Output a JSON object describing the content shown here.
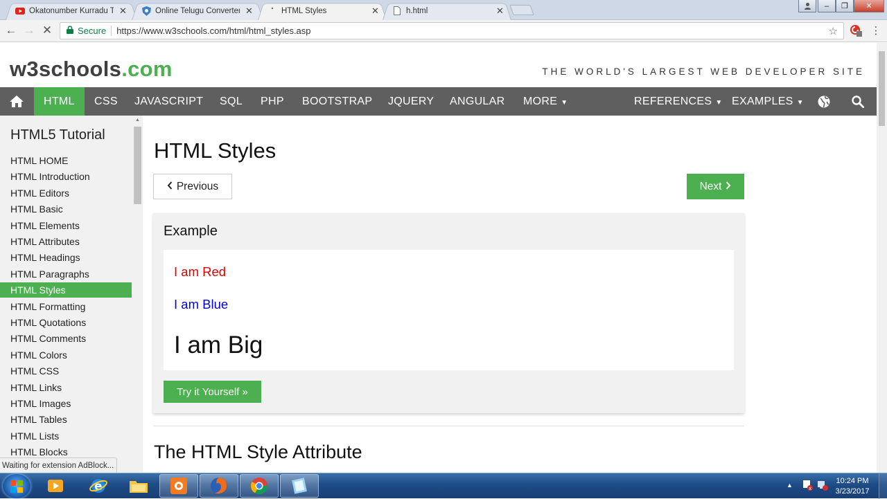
{
  "browser": {
    "tabs": [
      {
        "title": "Okatonumber Kurradu Te",
        "icon": "youtube-icon",
        "active": false
      },
      {
        "title": "Online Telugu Converter",
        "icon": "shield-icon",
        "active": false
      },
      {
        "title": "HTML Styles",
        "icon": "loading-icon",
        "active": true
      },
      {
        "title": "h.html",
        "icon": "file-icon",
        "active": false
      }
    ],
    "secure_label": "Secure",
    "url": "https://www.w3schools.com/html/html_styles.asp",
    "status_text": "Waiting for extension AdBlock..."
  },
  "site": {
    "logo_main": "w3schools",
    "logo_dot": ".com",
    "tagline": "THE WORLD'S LARGEST WEB DEVELOPER SITE",
    "nav": [
      "HTML",
      "CSS",
      "JAVASCRIPT",
      "SQL",
      "PHP",
      "BOOTSTRAP",
      "JQUERY",
      "ANGULAR",
      "MORE"
    ],
    "nav_right": [
      "REFERENCES",
      "EXAMPLES"
    ],
    "accent": "#4caf50"
  },
  "sidebar": {
    "title": "HTML5 Tutorial",
    "items": [
      "HTML HOME",
      "HTML Introduction",
      "HTML Editors",
      "HTML Basic",
      "HTML Elements",
      "HTML Attributes",
      "HTML Headings",
      "HTML Paragraphs",
      "HTML Styles",
      "HTML Formatting",
      "HTML Quotations",
      "HTML Comments",
      "HTML Colors",
      "HTML CSS",
      "HTML Links",
      "HTML Images",
      "HTML Tables",
      "HTML Lists",
      "HTML Blocks"
    ],
    "active_item": "HTML Styles"
  },
  "main": {
    "title": "HTML Styles",
    "prev_label": "Previous",
    "next_label": "Next",
    "example_title": "Example",
    "example_red": "I am Red",
    "example_blue": "I am Blue",
    "example_big": "I am Big",
    "try_label": "Try it Yourself »",
    "section_heading": "The HTML Style Attribute"
  },
  "taskbar": {
    "time": "10:24 PM",
    "date": "3/23/2017",
    "apps": [
      "media-player-icon",
      "internet-explorer-icon",
      "file-explorer-icon",
      "app-icon",
      "firefox-icon",
      "chrome-icon",
      "notepad-icon"
    ]
  }
}
